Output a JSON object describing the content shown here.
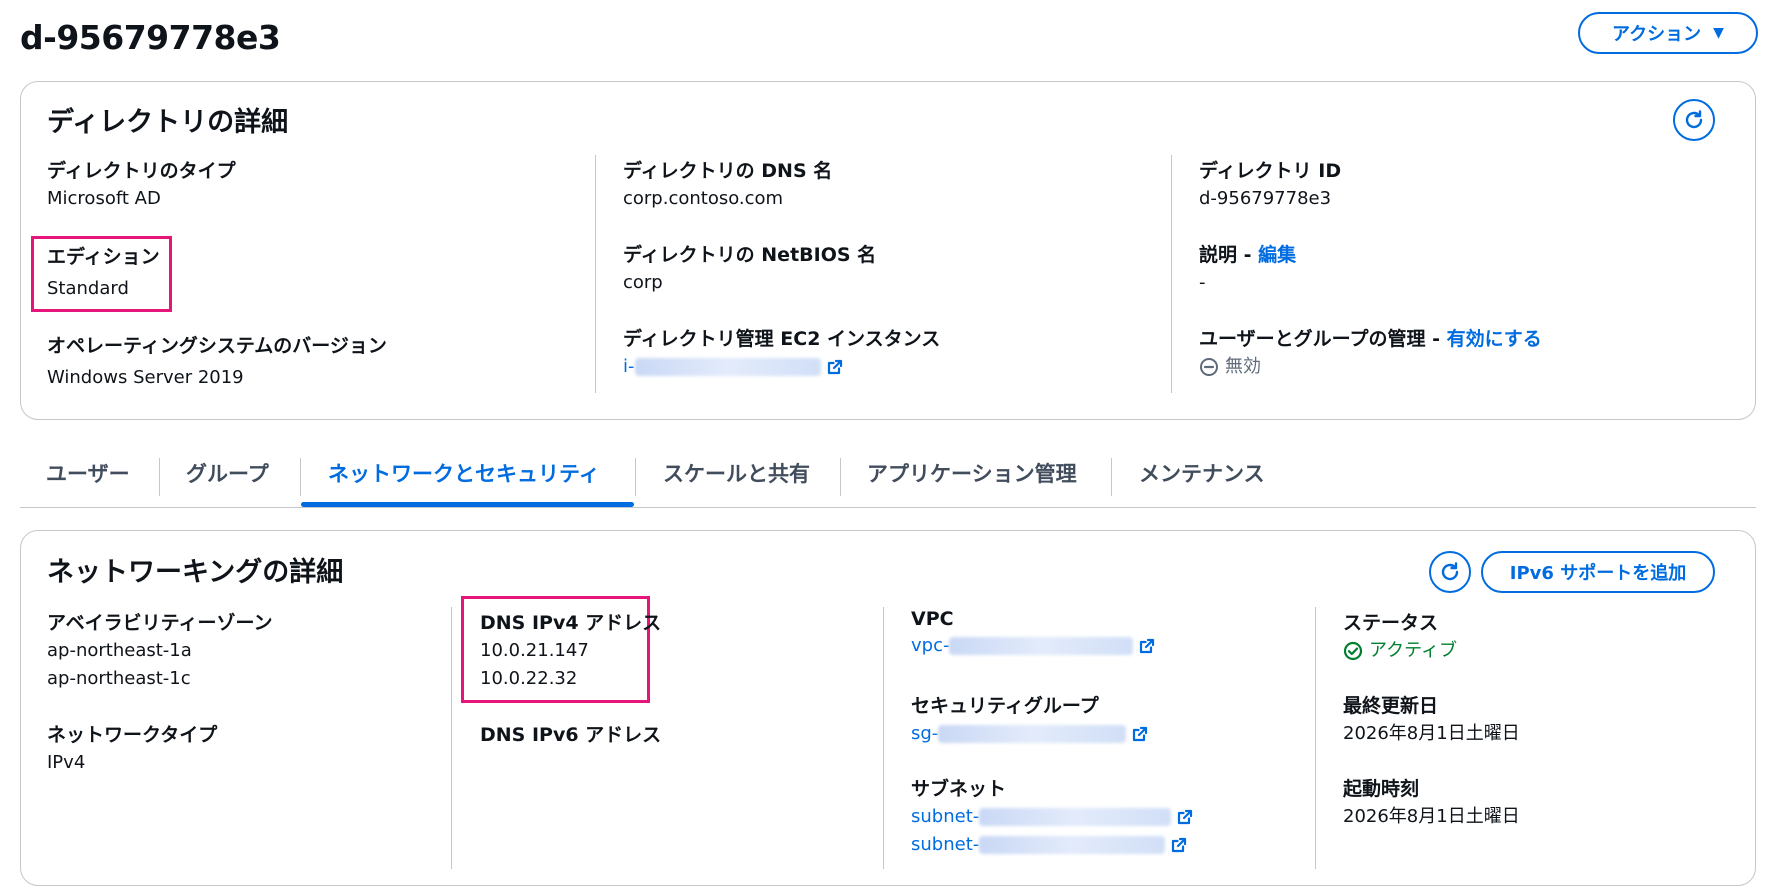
{
  "header": {
    "title": "d-95679778e3",
    "actions_label": "アクション",
    "actions_caret": "▼"
  },
  "directory_details": {
    "title": "ディレクトリの詳細",
    "type": {
      "label": "ディレクトリのタイプ",
      "value": "Microsoft AD"
    },
    "edition": {
      "label": "エディション",
      "value": "Standard"
    },
    "os_version": {
      "label": "オペレーティングシステムのバージョン",
      "value": "Windows Server 2019"
    },
    "dns_name": {
      "label": "ディレクトリの DNS 名",
      "value": "corp.contoso.com"
    },
    "netbios_name": {
      "label": "ディレクトリの NetBIOS 名",
      "value": "corp"
    },
    "ec2_instance": {
      "label": "ディレクトリ管理 EC2 インスタンス",
      "value_prefix": "i-"
    },
    "directory_id": {
      "label": "ディレクトリ ID",
      "value": "d-95679778e3"
    },
    "description": {
      "label": "説明",
      "separator": " - ",
      "edit_link": "編集",
      "value": "-"
    },
    "user_group_mgmt": {
      "label": "ユーザーとグループの管理",
      "separator": " - ",
      "enable_link": "有効にする",
      "status": "無効"
    }
  },
  "tabs": [
    {
      "label": "ユーザー"
    },
    {
      "label": "グループ"
    },
    {
      "label": "ネットワークとセキュリティ"
    },
    {
      "label": "スケールと共有"
    },
    {
      "label": "アプリケーション管理"
    },
    {
      "label": "メンテナンス"
    }
  ],
  "networking_details": {
    "title": "ネットワーキングの詳細",
    "add_ipv6_label": "IPv6 サポートを追加",
    "availability_zones": {
      "label": "アベイラビリティーゾーン",
      "values": [
        "ap-northeast-1a",
        "ap-northeast-1c"
      ]
    },
    "network_type": {
      "label": "ネットワークタイプ",
      "value": "IPv4"
    },
    "dns_ipv4": {
      "label": "DNS IPv4 アドレス",
      "values": [
        "10.0.21.147",
        "10.0.22.32"
      ]
    },
    "dns_ipv6": {
      "label": "DNS IPv6 アドレス"
    },
    "vpc": {
      "label": "VPC",
      "value_prefix": "vpc-"
    },
    "security_group": {
      "label": "セキュリティグループ",
      "value_prefix": "sg-"
    },
    "subnet": {
      "label": "サブネット",
      "value_prefixes": [
        "subnet-",
        "subnet-"
      ]
    },
    "status": {
      "label": "ステータス",
      "value": "アクティブ"
    },
    "last_updated": {
      "label": "最終更新日",
      "value": "2026年8月1日土曜日"
    },
    "launch_time": {
      "label": "起動時刻",
      "value": "2026年8月1日土曜日"
    }
  },
  "colors": {
    "accent": "#006ce0",
    "highlight": "#e5157a",
    "success": "#00802f"
  }
}
